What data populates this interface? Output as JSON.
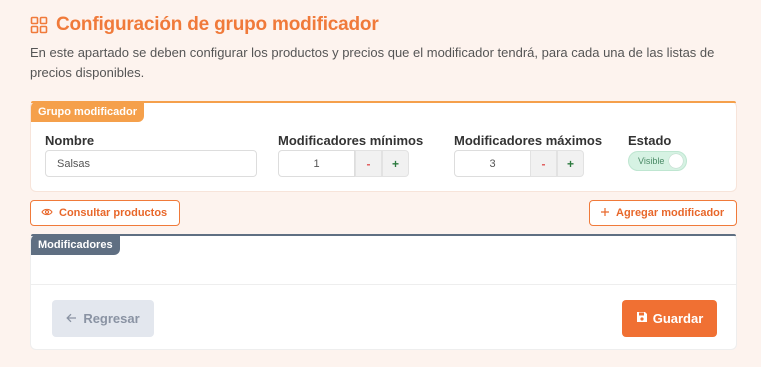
{
  "page": {
    "title": "Configuración de grupo modificador",
    "title_icon": "grid-icon",
    "description": "En este apartado se deben configurar los productos y precios que el modificador tendrá, para cada una de las listas de precios disponibles."
  },
  "group": {
    "tag": "Grupo modificador",
    "name_label": "Nombre",
    "name_value": "Salsas",
    "min_label": "Modificadores mínimos",
    "min_value": "1",
    "max_label": "Modificadores máximos",
    "max_value": "3",
    "minus": "-",
    "plus": "+",
    "status_label": "Estado",
    "status_value": "Visible"
  },
  "actions": {
    "consult_label": "Consultar productos",
    "consult_icon": "eye-icon",
    "add_label": "Agregar modificador",
    "add_icon": "plus-icon"
  },
  "modifiers": {
    "tag": "Modificadores"
  },
  "footer": {
    "back_label": "Regresar",
    "back_icon": "arrow-left-icon",
    "save_label": "Guardar",
    "save_icon": "floppy-disk-icon"
  },
  "colors": {
    "accent": "#f07a3a",
    "group_tag": "#f5a04b",
    "modifiers_tag": "#5f6f82",
    "background": "#fdf3ee",
    "toggle_on": "#d6f2e3"
  }
}
